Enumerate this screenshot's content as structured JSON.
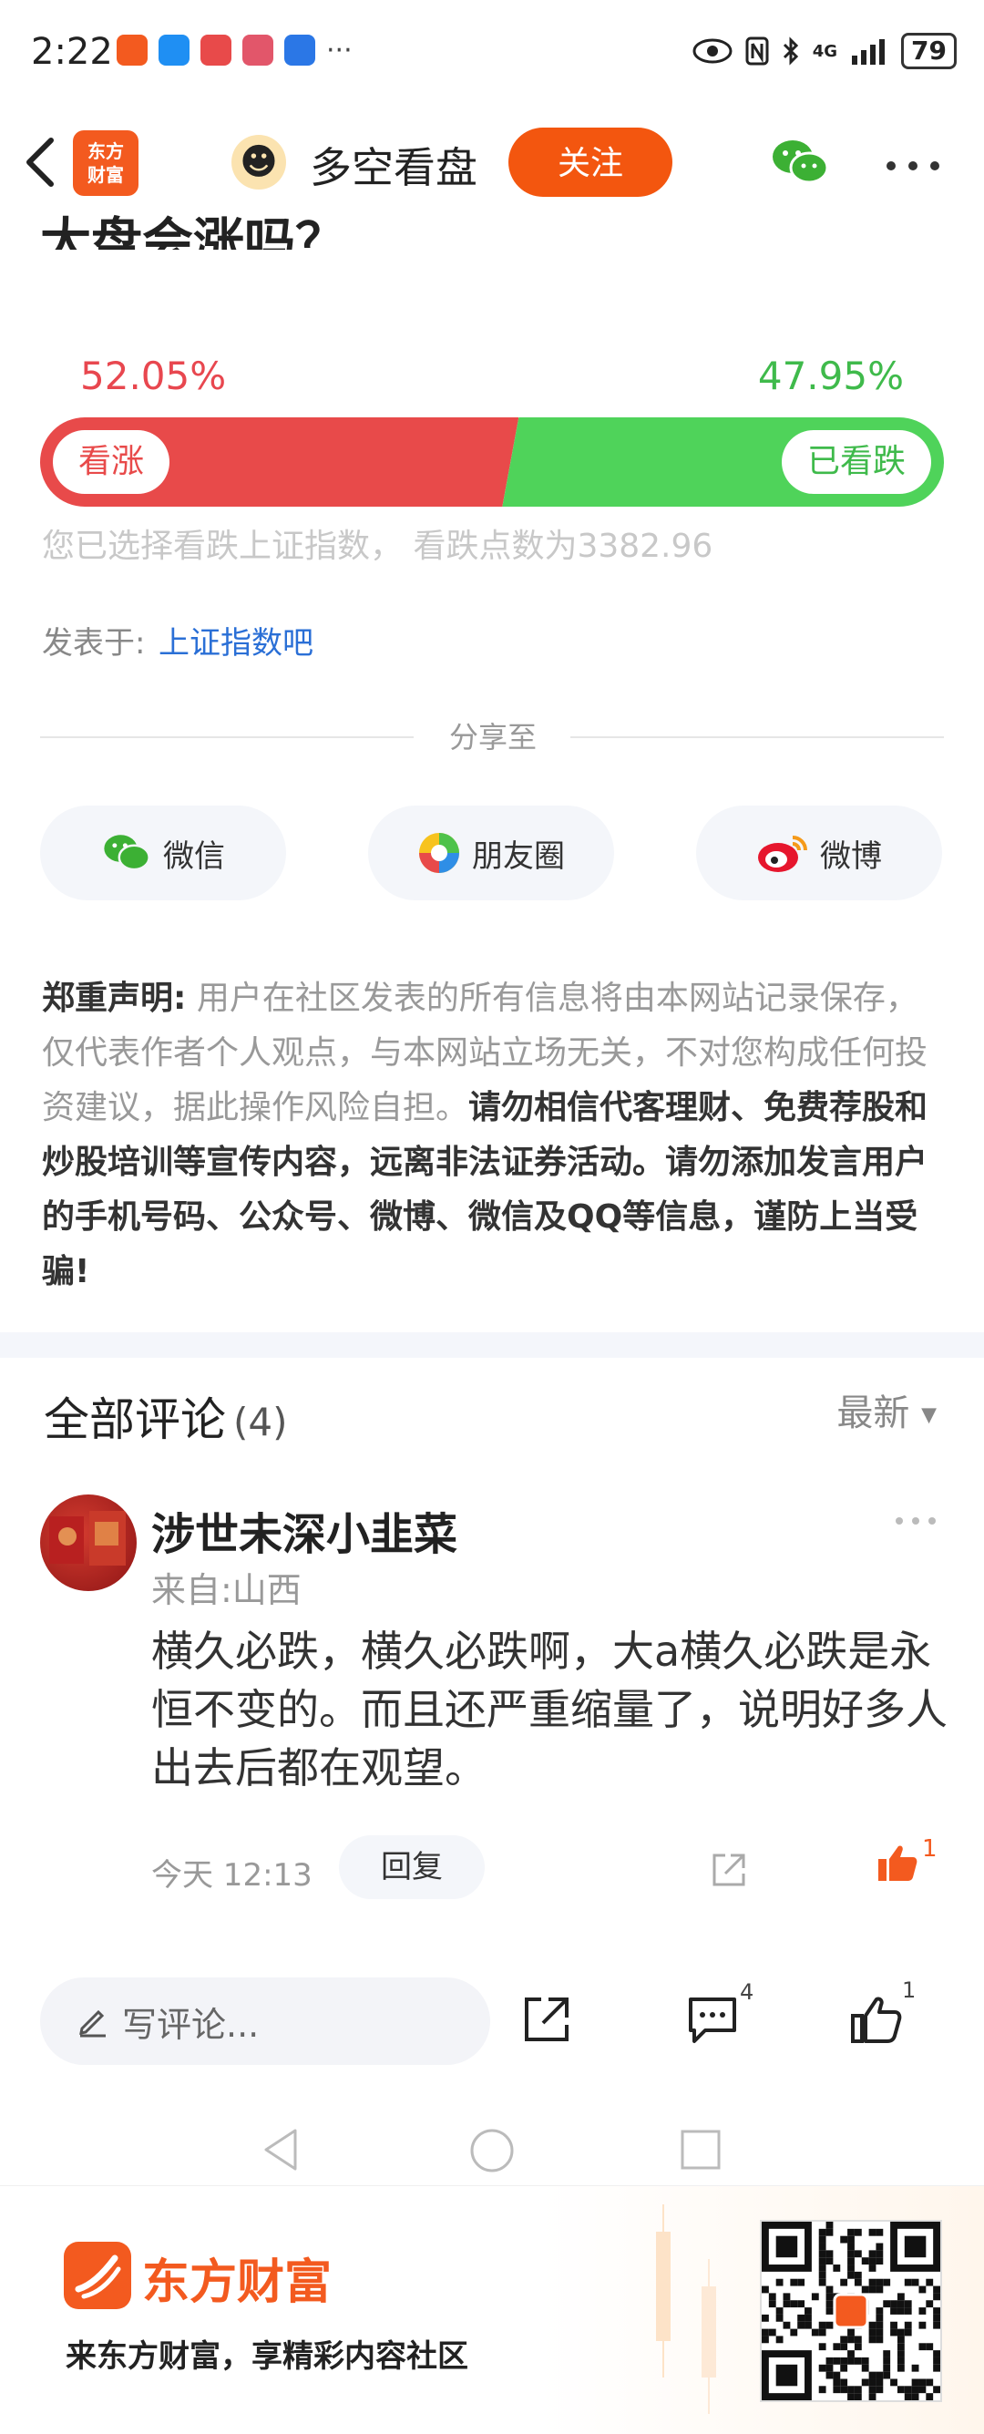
{
  "status_bar": {
    "time": "2:22",
    "more": "···",
    "network": "4G",
    "battery": "79"
  },
  "nav": {
    "logo_text_1": "东方",
    "logo_text_2": "财富",
    "title": "多空看盘",
    "follow_label": "关注"
  },
  "post": {
    "title_cut": "大盘会涨吗？"
  },
  "vote": {
    "up_pct": "52.05%",
    "down_pct": "47.95%",
    "up_fraction": 0.5205,
    "down_fraction": 0.4795,
    "up_label": "看涨",
    "down_label": "已看跌",
    "note": "您已选择看跌上证指数， 看跌点数为3382.96",
    "colors": {
      "up": "#e84a4a",
      "down": "#4fd35a"
    }
  },
  "posted": {
    "label": "发表于:",
    "forum": "上证指数吧"
  },
  "share": {
    "title": "分享至",
    "buttons": [
      {
        "label": "微信",
        "icon": "wechat-icon"
      },
      {
        "label": "朋友圈",
        "icon": "moments-icon"
      },
      {
        "label": "微博",
        "icon": "weibo-icon"
      }
    ]
  },
  "disclaimer": {
    "heading": "郑重声明:",
    "normal": " 用户在社区发表的所有信息将由本网站记录保存，仅代表作者个人观点，与本网站立场无关，不对您构成任何投资建议，据此操作风险自担。",
    "strong": "请勿相信代客理财、免费荐股和炒股培训等宣传内容，远离非法证券活动。请勿添加发言用户的手机号码、公众号、微博、微信及QQ等信息，谨防上当受骗!"
  },
  "comments": {
    "header": "全部评论",
    "count": "(4)",
    "sort": "最新",
    "items": [
      {
        "name": "涉世未深小韭菜",
        "location": "来自:山西",
        "text": "横久必跌，横久必跌啊，大a横久必跌是永恒不变的。而且还严重缩量了，说明好多人出去后都在观望。",
        "time": "今天 12:13",
        "reply_label": "回复",
        "likes": "1"
      }
    ]
  },
  "bottom_bar": {
    "input_placeholder": "写评论...",
    "comment_count": "4",
    "like_count": "1"
  },
  "footer": {
    "brand": "东方财富",
    "slogan": "来东方财富，享精彩内容社区"
  }
}
